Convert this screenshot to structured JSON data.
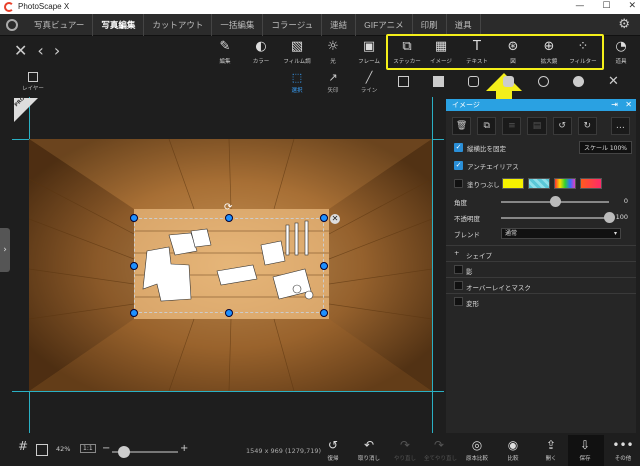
{
  "app": {
    "title": "PhotoScape X"
  },
  "window": {
    "minimize": "—",
    "maximize": "☐",
    "close": "✕"
  },
  "menu": {
    "tabs": [
      "写真ビュアー",
      "写真編集",
      "カットアウト",
      "一括編集",
      "コラージュ",
      "連結",
      "GIFアニメ",
      "印刷",
      "道具"
    ],
    "active": "写真編集"
  },
  "toolbar": {
    "buttons": [
      {
        "label": "編集",
        "icon": "edit-icon",
        "glyph": "✎"
      },
      {
        "label": "カラー",
        "icon": "color-icon",
        "glyph": "◐"
      },
      {
        "label": "フィルム調",
        "icon": "film-icon",
        "glyph": "▧"
      },
      {
        "label": "光",
        "icon": "light-icon",
        "glyph": "☼"
      },
      {
        "label": "フレーム",
        "icon": "frame-icon",
        "glyph": "▣"
      },
      {
        "label": "ステッカー",
        "icon": "sticker-icon",
        "glyph": "⧉"
      },
      {
        "label": "イメージ",
        "icon": "image-icon",
        "glyph": "▦"
      },
      {
        "label": "テキスト",
        "icon": "text-icon",
        "glyph": "T"
      },
      {
        "label": "図",
        "icon": "figure-icon",
        "glyph": "⊛"
      },
      {
        "label": "拡大鏡",
        "icon": "magnifier-icon",
        "glyph": "⊕"
      },
      {
        "label": "フィルター",
        "icon": "filter-icon",
        "glyph": "⁘"
      },
      {
        "label": "道具",
        "icon": "tools-icon",
        "glyph": "◔"
      }
    ]
  },
  "row2": {
    "layer": "レイヤー",
    "select": "選択",
    "arrow_tool": "矢印",
    "line_tool": "ライン"
  },
  "badge": {
    "pro": "PRO"
  },
  "panel": {
    "title": "イメージ",
    "keep_ratio": "縦横比を固定",
    "antialias": "アンチエイリアス",
    "fill": "塗りつぶし",
    "scale": "スケール 100%",
    "angle_label": "角度",
    "angle_value": "0",
    "angle_fraction": 0.5,
    "opacity_label": "不透明度",
    "opacity_value": "100",
    "opacity_fraction": 1.0,
    "blend_label": "ブレンド",
    "blend_value": "通常",
    "sections": [
      "シェイプ",
      "影",
      "オーバーレイとマスク",
      "変形"
    ],
    "swatch_colors": [
      "#f5f200",
      "#5ac8d8",
      "#e040c0",
      "#ff5a1e"
    ]
  },
  "bottom": {
    "zoom": "42%",
    "one_to_one": "1:1",
    "dims": "1549 x 969 (1279,719)",
    "zoom_fraction": 0.12,
    "buttons": [
      {
        "label": "復帰",
        "glyph": "↺",
        "enabled": true
      },
      {
        "label": "取り消し",
        "glyph": "↶",
        "enabled": true
      },
      {
        "label": "やり直し",
        "glyph": "↷",
        "enabled": false
      },
      {
        "label": "全てやり直し",
        "glyph": "↷",
        "enabled": false
      },
      {
        "label": "原本比較",
        "glyph": "◎",
        "enabled": true
      },
      {
        "label": "比較",
        "glyph": "◉",
        "enabled": true
      },
      {
        "label": "開く",
        "glyph": "⇪",
        "enabled": true
      },
      {
        "label": "保存",
        "glyph": "⇩",
        "enabled": true
      },
      {
        "label": "その他",
        "glyph": "•••",
        "enabled": true
      }
    ]
  },
  "colors": {
    "accent": "#2aa1e2",
    "highlight": "#f4ef1a",
    "guide": "#2ab0c4"
  }
}
